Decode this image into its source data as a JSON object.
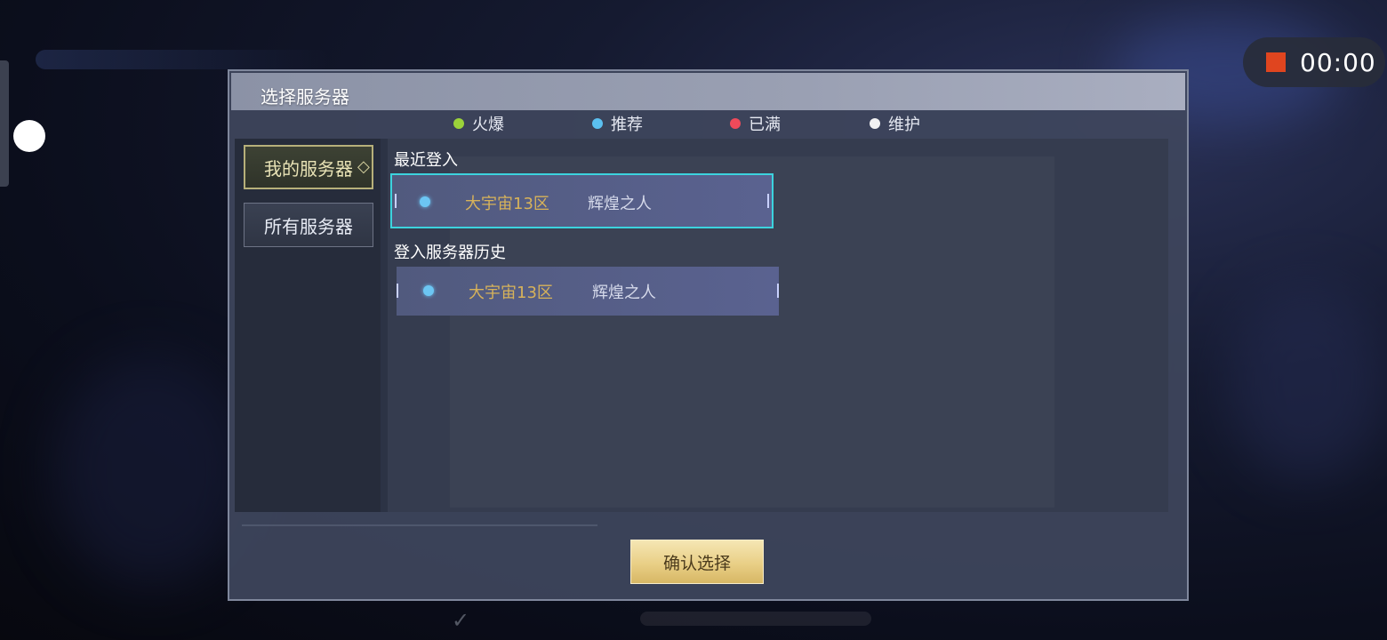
{
  "recording": {
    "time": "00:00"
  },
  "dialog": {
    "title": "选择服务器",
    "legend": [
      {
        "label": "火爆",
        "color": "#9bd33a"
      },
      {
        "label": "推荐",
        "color": "#5bc0f0"
      },
      {
        "label": "已满",
        "color": "#f04a5a"
      },
      {
        "label": "维护",
        "color": "#f2f2f2"
      }
    ],
    "nav": {
      "my_servers": "我的服务器",
      "all_servers": "所有服务器"
    },
    "recent": {
      "label": "最近登入",
      "server": "大宇宙13区",
      "role": "辉煌之人"
    },
    "history": {
      "label": "登入服务器历史",
      "items": [
        {
          "server": "大宇宙13区",
          "role": "辉煌之人"
        }
      ]
    },
    "confirm_label": "确认选择"
  }
}
